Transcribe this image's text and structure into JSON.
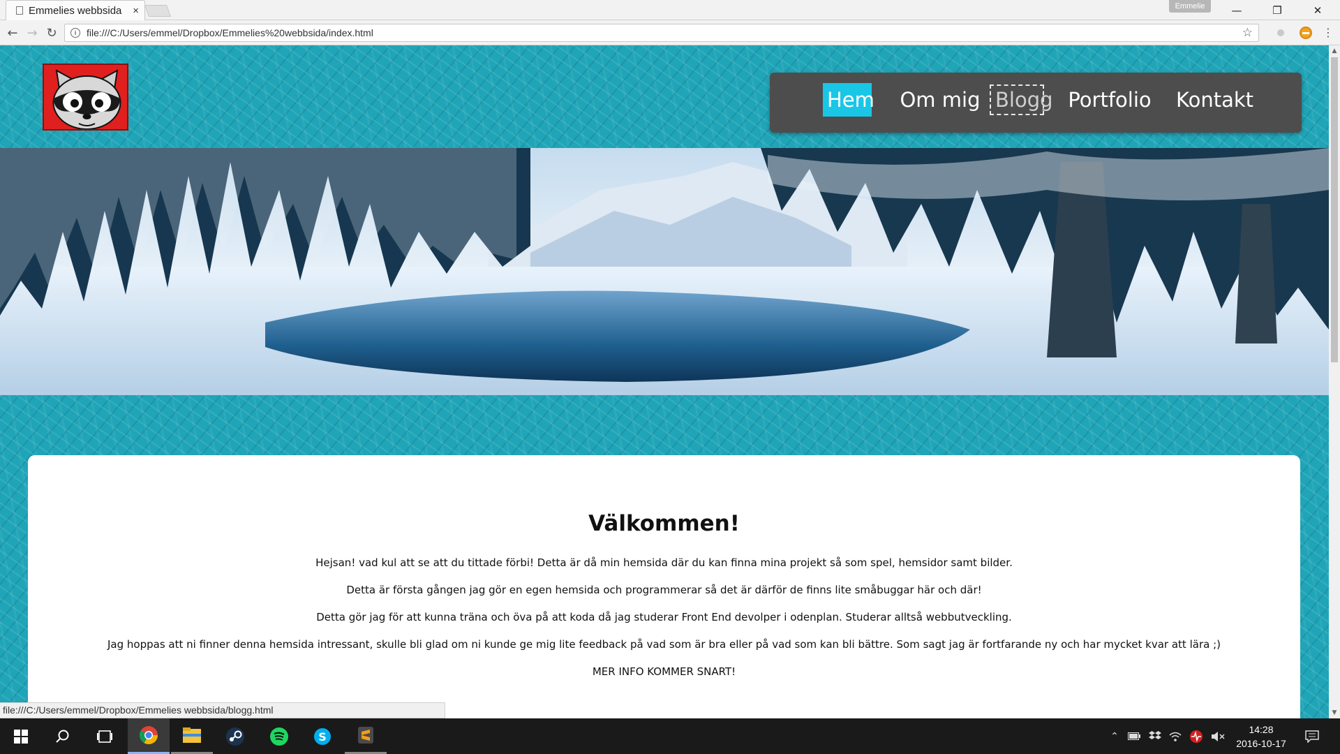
{
  "browser": {
    "tab_title": "Emmelies webbsida",
    "tab_close": "×",
    "profile_name": "Emmelie",
    "url": "file:///C:/Users/emmel/Dropbox/Emmelies%20webbsida/index.html",
    "status_url": "file:///C:/Users/emmel/Dropbox/Emmelies webbsida/blogg.html"
  },
  "site": {
    "nav": {
      "home": "Hem",
      "about": "Om mig",
      "blog": "Blogg",
      "portfolio": "Portfolio",
      "contact": "Kontakt"
    },
    "welcome": {
      "heading": "Välkommen!",
      "paragraphs": [
        "Hejsan! vad kul att se att du tittade förbi! Detta är då min hemsida där du kan finna mina projekt så som spel, hemsidor samt bilder.",
        "Detta är första gången jag gör en egen hemsida och programmerar så det är därför de finns lite småbuggar här och där!",
        "Detta gör jag för att kunna träna och öva på att koda då jag studerar Front End devolper i odenplan. Studerar alltså webbutveckling.",
        "Jag hoppas att ni finner denna hemsida intressant, skulle bli glad om ni kunde ge mig lite feedback på vad som är bra eller på vad som kan bli bättre. Som sagt jag är fortfarande ny och har mycket kvar att lära ;)",
        "MER INFO KOMMER SNART!"
      ]
    },
    "colors": {
      "background": "#1fa5b7",
      "nav_bg": "#4d4d4d",
      "nav_active": "#19c6e6",
      "logo_bg": "#e0201e"
    }
  },
  "taskbar": {
    "time": "14:28",
    "date": "2016-10-17",
    "apps": [
      "start-icon",
      "search-icon",
      "task-view-icon",
      "chrome-icon",
      "file-explorer-icon",
      "steam-icon",
      "spotify-icon",
      "skype-icon",
      "sublime-text-icon"
    ]
  }
}
